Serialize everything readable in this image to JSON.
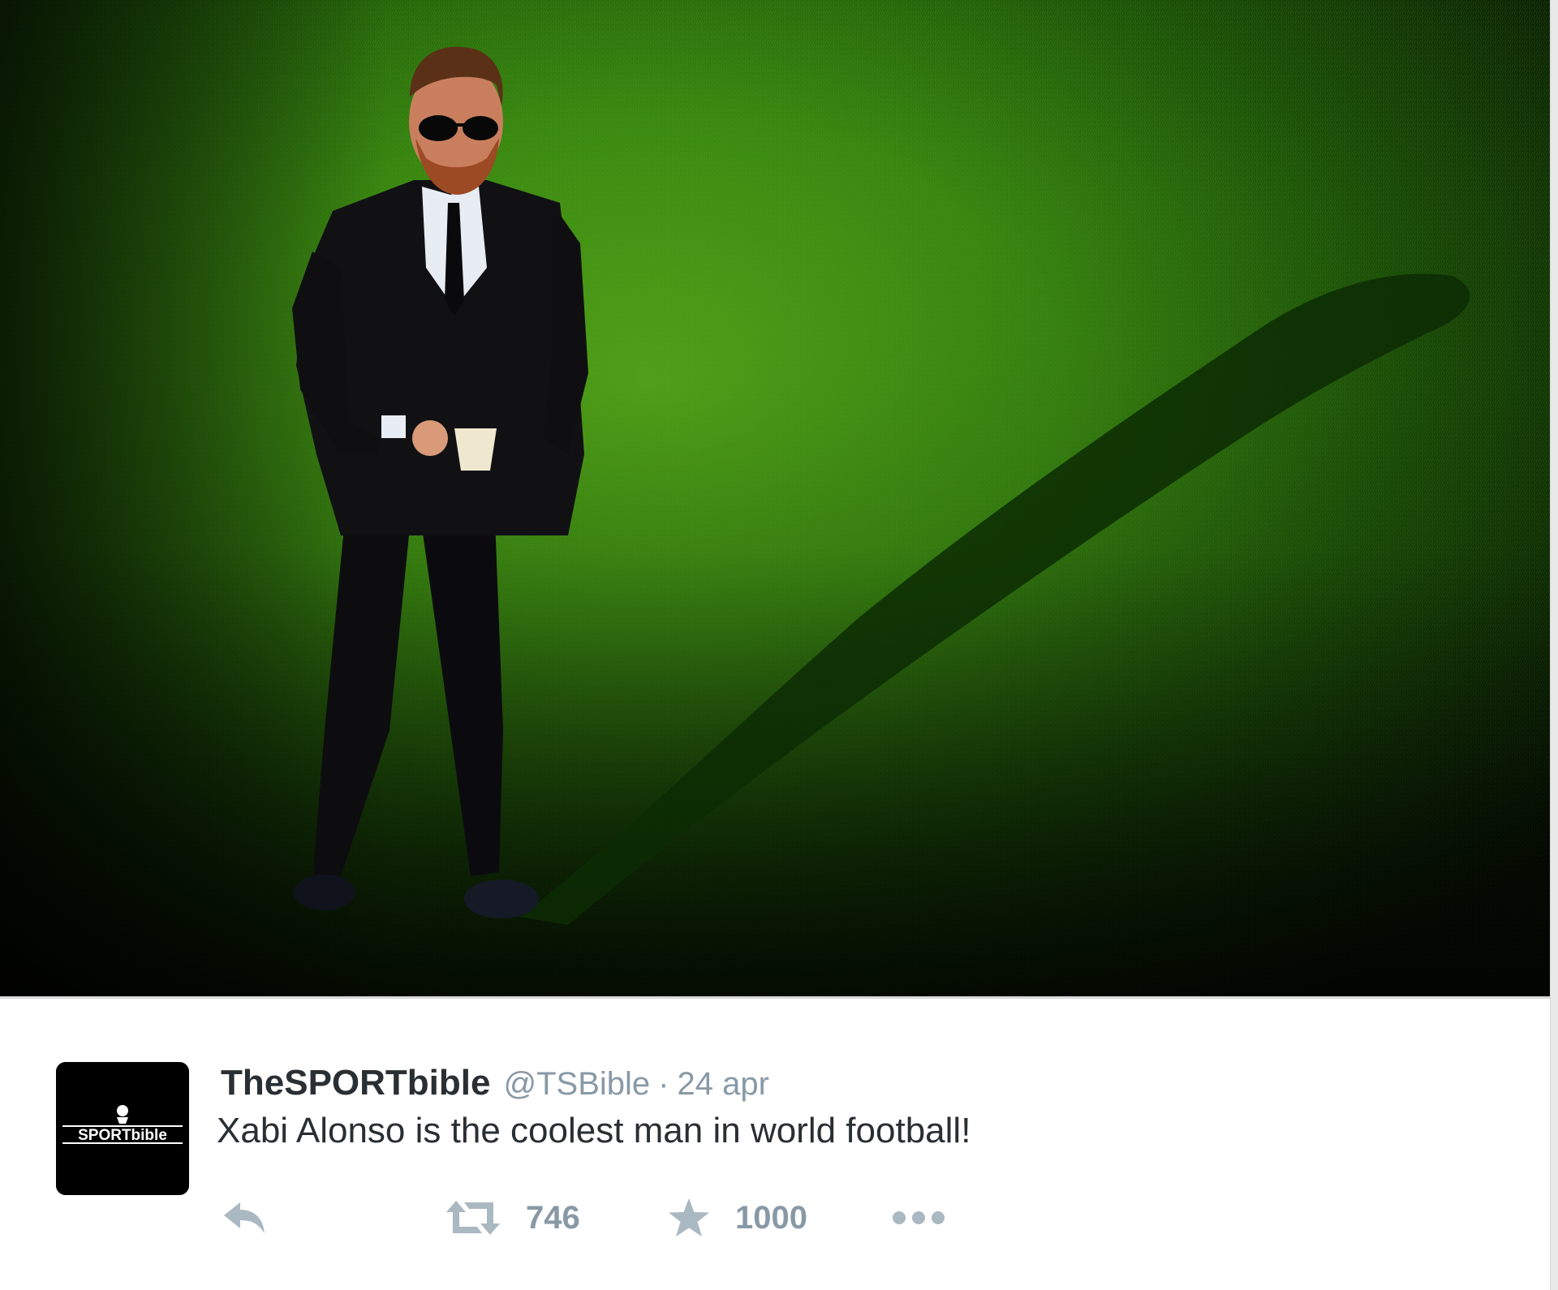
{
  "tweet": {
    "author_name": "TheSPORTbible",
    "handle": "@TSBible",
    "separator": "·",
    "date": "24 apr",
    "text": "Xabi Alonso is the coolest man in world football!",
    "avatar_logo_text": "SPORTbible",
    "media_description": "Man in dark suit and sunglasses holding a cup, standing on sunlit grass pitch casting a long shadow"
  },
  "actions": {
    "reply_icon": "reply-icon",
    "retweet_icon": "retweet-icon",
    "retweet_count": "746",
    "favorite_icon": "star-icon",
    "favorite_count": "1000",
    "more_icon": "more-dots-icon"
  },
  "colors": {
    "text_primary": "#292f33",
    "text_secondary": "#8899a6",
    "grass": "#1f6a0a",
    "avatar_bg": "#000000"
  }
}
